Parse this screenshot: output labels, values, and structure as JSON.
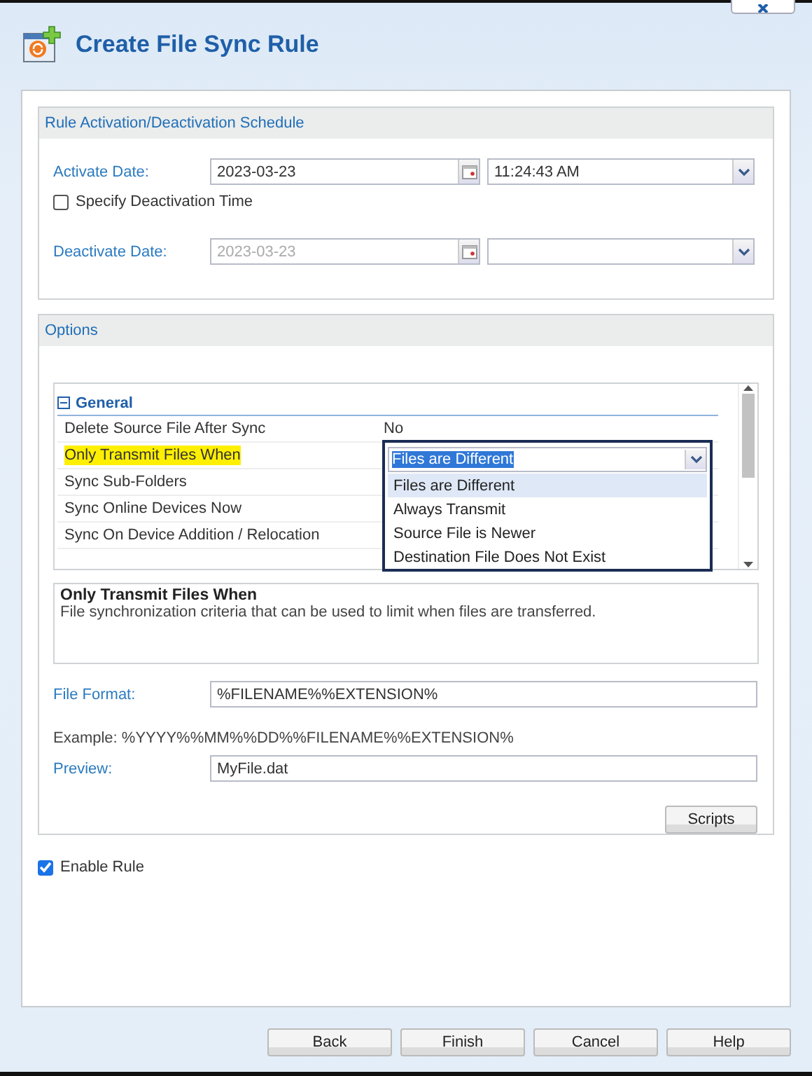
{
  "window": {
    "title": "Create File Sync Rule"
  },
  "schedule": {
    "title": "Rule Activation/Deactivation Schedule",
    "activate": {
      "label": "Activate Date:",
      "date": "2023-03-23",
      "time": "11:24:43 AM",
      "disabled": false
    },
    "deactivate_checkbox": {
      "label": "Specify Deactivation Time",
      "checked": false
    },
    "deactivate": {
      "label": "Deactivate Date:",
      "date": "2023-03-23",
      "disabled": true
    }
  },
  "options": {
    "title": "Options",
    "group": {
      "title": "General",
      "expanded": true
    },
    "properties": [
      {
        "name": "Delete Source File After Sync",
        "value": "No",
        "highlighted": false
      },
      {
        "name": "Only Transmit Files When",
        "highlighted": true
      },
      {
        "name": "Sync Sub-Folders",
        "highlighted": false
      },
      {
        "name": "Sync Online Devices Now",
        "highlighted": false
      },
      {
        "name": "Sync On Device Addition / Relocation",
        "highlighted": false
      }
    ],
    "dropdown": {
      "value": "Files are Different",
      "options": [
        {
          "label": "Files are Different",
          "selected": true
        },
        {
          "label": "Always Transmit",
          "selected": false
        },
        {
          "label": "Source File is Newer",
          "selected": false
        },
        {
          "label": "Destination File Does Not Exist",
          "selected": false
        }
      ]
    },
    "description": {
      "title": "Only Transmit Files When",
      "text": "File synchronization criteria that can be used to limit when files are transferred."
    },
    "file_format": {
      "label": "File Format:",
      "value": "%FILENAME%%EXTENSION%"
    },
    "example": "Example: %YYYY%%MM%%DD%%FILENAME%%EXTENSION%",
    "preview": {
      "label": "Preview:",
      "value": "MyFile.dat"
    },
    "scripts_button": "Scripts"
  },
  "enable_rule": {
    "label": "Enable Rule",
    "checked": true
  },
  "buttons": [
    "Back",
    "Finish",
    "Cancel",
    "Help"
  ]
}
